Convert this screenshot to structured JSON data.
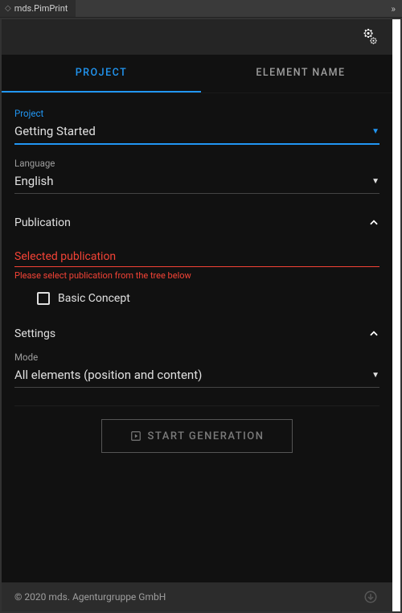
{
  "window": {
    "title": "mds.PimPrint"
  },
  "tabs": {
    "project": "PROJECT",
    "element_name": "ELEMENT NAME"
  },
  "fields": {
    "project": {
      "label": "Project",
      "value": "Getting Started"
    },
    "language": {
      "label": "Language",
      "value": "English"
    }
  },
  "publication": {
    "title": "Publication",
    "selected_label": "Selected publication",
    "hint": "Please select publication from the tree below",
    "tree": {
      "item0": "Basic Concept"
    }
  },
  "settings": {
    "title": "Settings",
    "mode": {
      "label": "Mode",
      "value": "All elements (position and content)"
    }
  },
  "actions": {
    "start": "START GENERATION"
  },
  "footer": {
    "copyright": "© 2020 mds. Agenturgruppe GmbH"
  }
}
